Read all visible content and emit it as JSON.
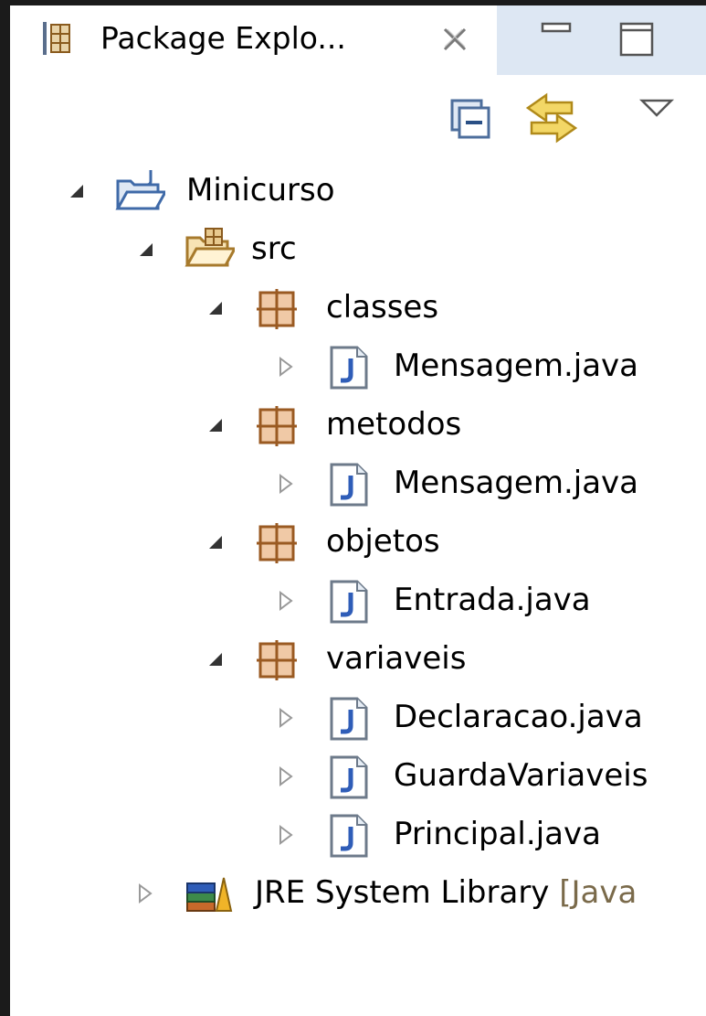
{
  "view": {
    "title": "Package Explo...",
    "close_icon": "close-icon",
    "minimize_icon": "minimize-icon",
    "maximize_icon": "maximize-icon"
  },
  "toolbar": {
    "collapse_all_icon": "collapse-all-icon",
    "link_with_editor_icon": "link-with-editor-icon",
    "view_menu_icon": "view-menu-chevron-icon"
  },
  "tree": {
    "project": {
      "label": "Minicurso",
      "expanded": true
    },
    "src": {
      "label": "src",
      "expanded": true
    },
    "packages": [
      {
        "label": "classes",
        "files": [
          "Mensagem.java"
        ]
      },
      {
        "label": "metodos",
        "files": [
          "Mensagem.java"
        ]
      },
      {
        "label": "objetos",
        "files": [
          "Entrada.java"
        ]
      },
      {
        "label": "variaveis",
        "files": [
          "Declaracao.java",
          "GuardaVariaveis",
          "Principal.java"
        ]
      }
    ],
    "library": {
      "label": "JRE System Library",
      "decoration": "[Java",
      "expanded": false
    }
  }
}
